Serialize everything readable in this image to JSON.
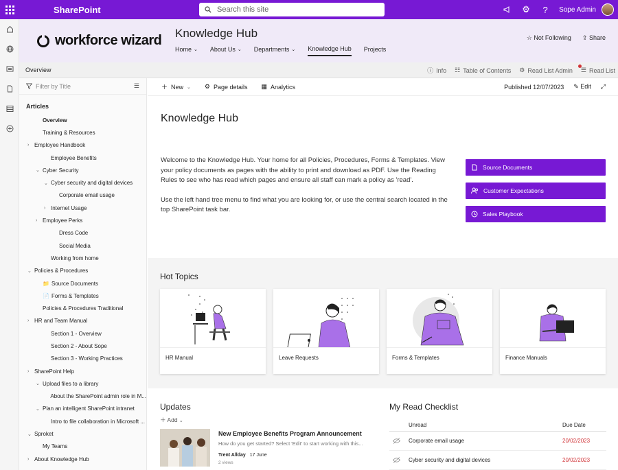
{
  "suitebar": {
    "app_name": "SharePoint",
    "search_placeholder": "Search this site",
    "user_name": "Sope Admin"
  },
  "site": {
    "logo_text": "workforce wizard",
    "title": "Knowledge Hub",
    "nav": [
      {
        "label": "Home",
        "has_chevron": true
      },
      {
        "label": "About Us",
        "has_chevron": true
      },
      {
        "label": "Departments",
        "has_chevron": true
      },
      {
        "label": "Knowledge Hub",
        "has_chevron": false,
        "active": true
      },
      {
        "label": "Projects",
        "has_chevron": false
      }
    ],
    "follow_label": "Not Following",
    "share_label": "Share"
  },
  "overview_bar": {
    "label": "Overview",
    "info": "Info",
    "toc": "Table of Contents",
    "read_list_admin": "Read List Admin",
    "read_list": "Read List"
  },
  "tree": {
    "filter_placeholder": "Filter by Title",
    "heading": "Articles",
    "items": [
      {
        "label": "Overview",
        "indent": 1,
        "chev": "",
        "selected": true
      },
      {
        "label": "Training & Resources",
        "indent": 1,
        "chev": ""
      },
      {
        "label": "Employee Handbook",
        "indent": 0,
        "chev": "›"
      },
      {
        "label": "Employee Benefits",
        "indent": 2,
        "chev": ""
      },
      {
        "label": "Cyber Security",
        "indent": 1,
        "chev": "⌄"
      },
      {
        "label": "Cyber security and digital devices",
        "indent": 2,
        "chev": "⌄"
      },
      {
        "label": "Corporate email usage",
        "indent": 3,
        "chev": ""
      },
      {
        "label": "Internet Usage",
        "indent": 2,
        "chev": "›"
      },
      {
        "label": "Employee Perks",
        "indent": 1,
        "chev": "›"
      },
      {
        "label": "Dress Code",
        "indent": 3,
        "chev": ""
      },
      {
        "label": "Social Media",
        "indent": 3,
        "chev": ""
      },
      {
        "label": "Working from home",
        "indent": 2,
        "chev": ""
      },
      {
        "label": "Policies & Procedures",
        "indent": 0,
        "chev": "⌄"
      },
      {
        "label": "Source Documents",
        "indent": 1,
        "chev": "",
        "icon": "folder"
      },
      {
        "label": "Forms & Templates",
        "indent": 1,
        "chev": "",
        "icon": "doc"
      },
      {
        "label": "Policies & Procedures Traditional",
        "indent": 1,
        "chev": ""
      },
      {
        "label": "HR and Team Manual",
        "indent": 0,
        "chev": "›"
      },
      {
        "label": "Section 1 - Overview",
        "indent": 2,
        "chev": ""
      },
      {
        "label": "Section 2 - About Sope",
        "indent": 2,
        "chev": ""
      },
      {
        "label": "Section 3 - Working Practices",
        "indent": 2,
        "chev": ""
      },
      {
        "label": "SharePoint Help",
        "indent": 0,
        "chev": "›"
      },
      {
        "label": "Upload files to a library",
        "indent": 1,
        "chev": "⌄"
      },
      {
        "label": "About the SharePoint admin role in M...",
        "indent": 2,
        "chev": ""
      },
      {
        "label": "Plan an intelligent SharePoint intranet",
        "indent": 1,
        "chev": "⌄"
      },
      {
        "label": "Intro to file collaboration in Microsoft ...",
        "indent": 2,
        "chev": ""
      },
      {
        "label": "Sproket",
        "indent": 0,
        "chev": "⌄"
      },
      {
        "label": "My Teams",
        "indent": 1,
        "chev": ""
      },
      {
        "label": "About Knowledge Hub",
        "indent": 0,
        "chev": "›"
      }
    ]
  },
  "page_cmd": {
    "new": "New",
    "page_details": "Page details",
    "analytics": "Analytics",
    "published": "Published 12/07/2023",
    "edit": "Edit"
  },
  "content": {
    "title": "Knowledge Hub",
    "intro_p1": "Welcome to the Knowledge Hub. Your home for all Policies, Procedures, Forms & Templates. View your policy documents as pages with the ability to print and download as PDF. Use the Reading Rules to see who has read which pages and ensure all staff can mark a policy as 'read'.",
    "intro_p2": "Use the left hand tree menu to find what you are looking for, or use the central search located in the top SharePoint task bar.",
    "quick_links": [
      {
        "label": "Source Documents",
        "icon": "document-icon"
      },
      {
        "label": "Customer Expectations",
        "icon": "people-icon"
      },
      {
        "label": "Sales Playbook",
        "icon": "clock-icon"
      }
    ],
    "hot_topics_title": "Hot Topics",
    "hot_topics": [
      "HR Manual",
      "Leave Requests",
      "Forms & Templates",
      "Finance Manuals"
    ],
    "updates_title": "Updates",
    "add_label": "Add",
    "news": {
      "title": "New Employee Benefits Program Announcement",
      "desc": "How do you get started? Select 'Edit' to start working with this...",
      "author": "Trent Allday",
      "date": "17 June",
      "views": "2 views"
    },
    "read_checklist": {
      "title": "My Read Checklist",
      "col_unread": "Unread",
      "col_due": "Due Date",
      "rows": [
        {
          "title": "Corporate email usage",
          "due": "20/02/2023"
        },
        {
          "title": "Cyber security and digital devices",
          "due": "20/02/2023"
        }
      ]
    }
  },
  "colors": {
    "brand": "#7719d4",
    "header_bg": "#f0eaf8",
    "due_red": "#d13438"
  }
}
